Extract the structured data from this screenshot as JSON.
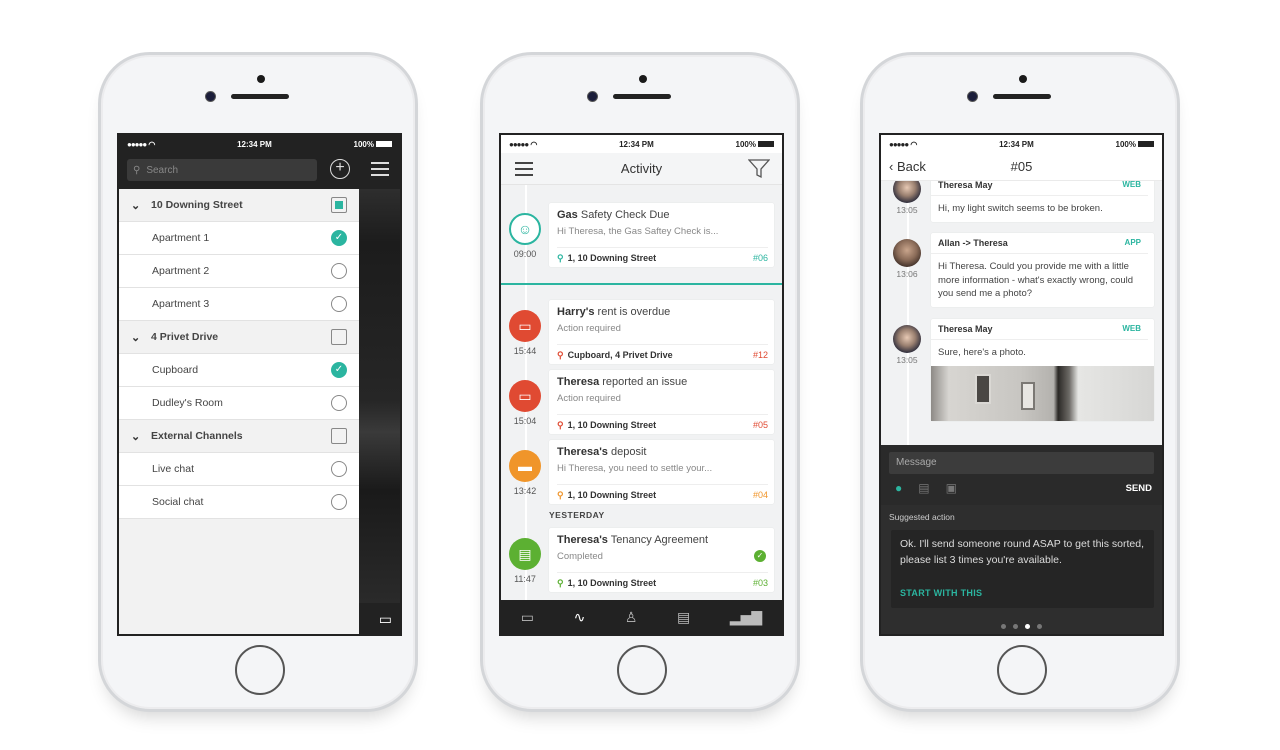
{
  "status_bar": {
    "signal": "●●●●●",
    "wifi": "wifi-icon",
    "time": "12:34 PM",
    "battery": "100%"
  },
  "colors": {
    "accent": "#2bb5a0",
    "alert": "#e04a32",
    "warning": "#f0952a",
    "success": "#5cb032",
    "dark": "#222222"
  },
  "filters_screen": {
    "search_placeholder": "Search",
    "add_icon": "plus-circle-icon",
    "menu_icon": "hamburger-icon",
    "groups": [
      {
        "label": "10 Downing Street",
        "state": "partial",
        "items": [
          {
            "label": "Apartment 1",
            "checked": true
          },
          {
            "label": "Apartment 2",
            "checked": false
          },
          {
            "label": "Apartment 3",
            "checked": false
          }
        ]
      },
      {
        "label": "4 Privet Drive",
        "state": "unchecked",
        "items": [
          {
            "label": "Cupboard",
            "checked": true
          },
          {
            "label": "Dudley's Room",
            "checked": false
          }
        ]
      },
      {
        "label": "External Channels",
        "state": "unchecked",
        "items": [
          {
            "label": "Live chat",
            "checked": false
          },
          {
            "label": "Social chat",
            "checked": false
          }
        ]
      }
    ],
    "chat_icon": "chat-bubble-icon"
  },
  "activity_screen": {
    "title": "Activity",
    "activities": [
      {
        "time": "09:00",
        "icon": "engineer-icon",
        "color": "#2bb5a0",
        "title_bold": "Gas",
        "title_rest": " Safety Check Due",
        "subtitle": "Hi Theresa, the Gas Saftey Check is...",
        "location": "1, 10 Downing Street",
        "ref": "#06"
      },
      {
        "time": "15:44",
        "icon": "chat-bubble-icon",
        "color": "#e04a32",
        "title_bold": "Harry's",
        "title_rest": " rent is overdue",
        "subtitle": "Action required",
        "location": "Cupboard, 4 Privet Drive",
        "ref": "#12"
      },
      {
        "time": "15:04",
        "icon": "chat-bubble-icon",
        "color": "#e04a32",
        "title_bold": "Theresa",
        "title_rest": " reported an issue",
        "subtitle": "Action required",
        "location": "1, 10 Downing Street",
        "ref": "#05"
      },
      {
        "time": "13:42",
        "icon": "credit-card-icon",
        "color": "#f0952a",
        "title_bold": "Theresa's",
        "title_rest": " deposit",
        "subtitle": "Hi Theresa, you need to settle your...",
        "location": "1, 10 Downing Street",
        "ref": "#04"
      },
      {
        "time": "11:47",
        "icon": "document-icon",
        "color": "#5cb032",
        "title_bold": "Theresa's",
        "title_rest": " Tenancy Agreement",
        "subtitle": "Completed",
        "location": "1, 10 Downing Street",
        "ref": "#03"
      }
    ],
    "section_yesterday": "YESTERDAY",
    "tabs": [
      "chat-tab",
      "activity-tab",
      "people-tab",
      "documents-tab",
      "stats-tab"
    ],
    "active_tab": "activity-tab"
  },
  "conversation_screen": {
    "back_label": "Back",
    "title": "#05",
    "messages": [
      {
        "author": "Theresa May",
        "source": "WEB",
        "time": "13:05",
        "text": "Hi, my light switch seems to be broken."
      },
      {
        "author": "Allan -> Theresa",
        "source": "APP",
        "time": "13:06",
        "text": "Hi Theresa. Could you provide me with a little more information - what's exactly wrong, could you send me a photo?"
      },
      {
        "author": "Theresa May",
        "source": "WEB",
        "time": "13:05",
        "text": "Sure, here's a photo.",
        "attachment": "light-switch-photo"
      }
    ],
    "message_placeholder": "Message",
    "send_label": "SEND",
    "suggested_label": "Suggested action",
    "suggested_text": "Ok. I'll send someone round ASAP to get this sorted, please list 3 times you're available.",
    "suggested_button": "START WITH THIS",
    "pager": {
      "pages": 4,
      "current": 3
    }
  }
}
